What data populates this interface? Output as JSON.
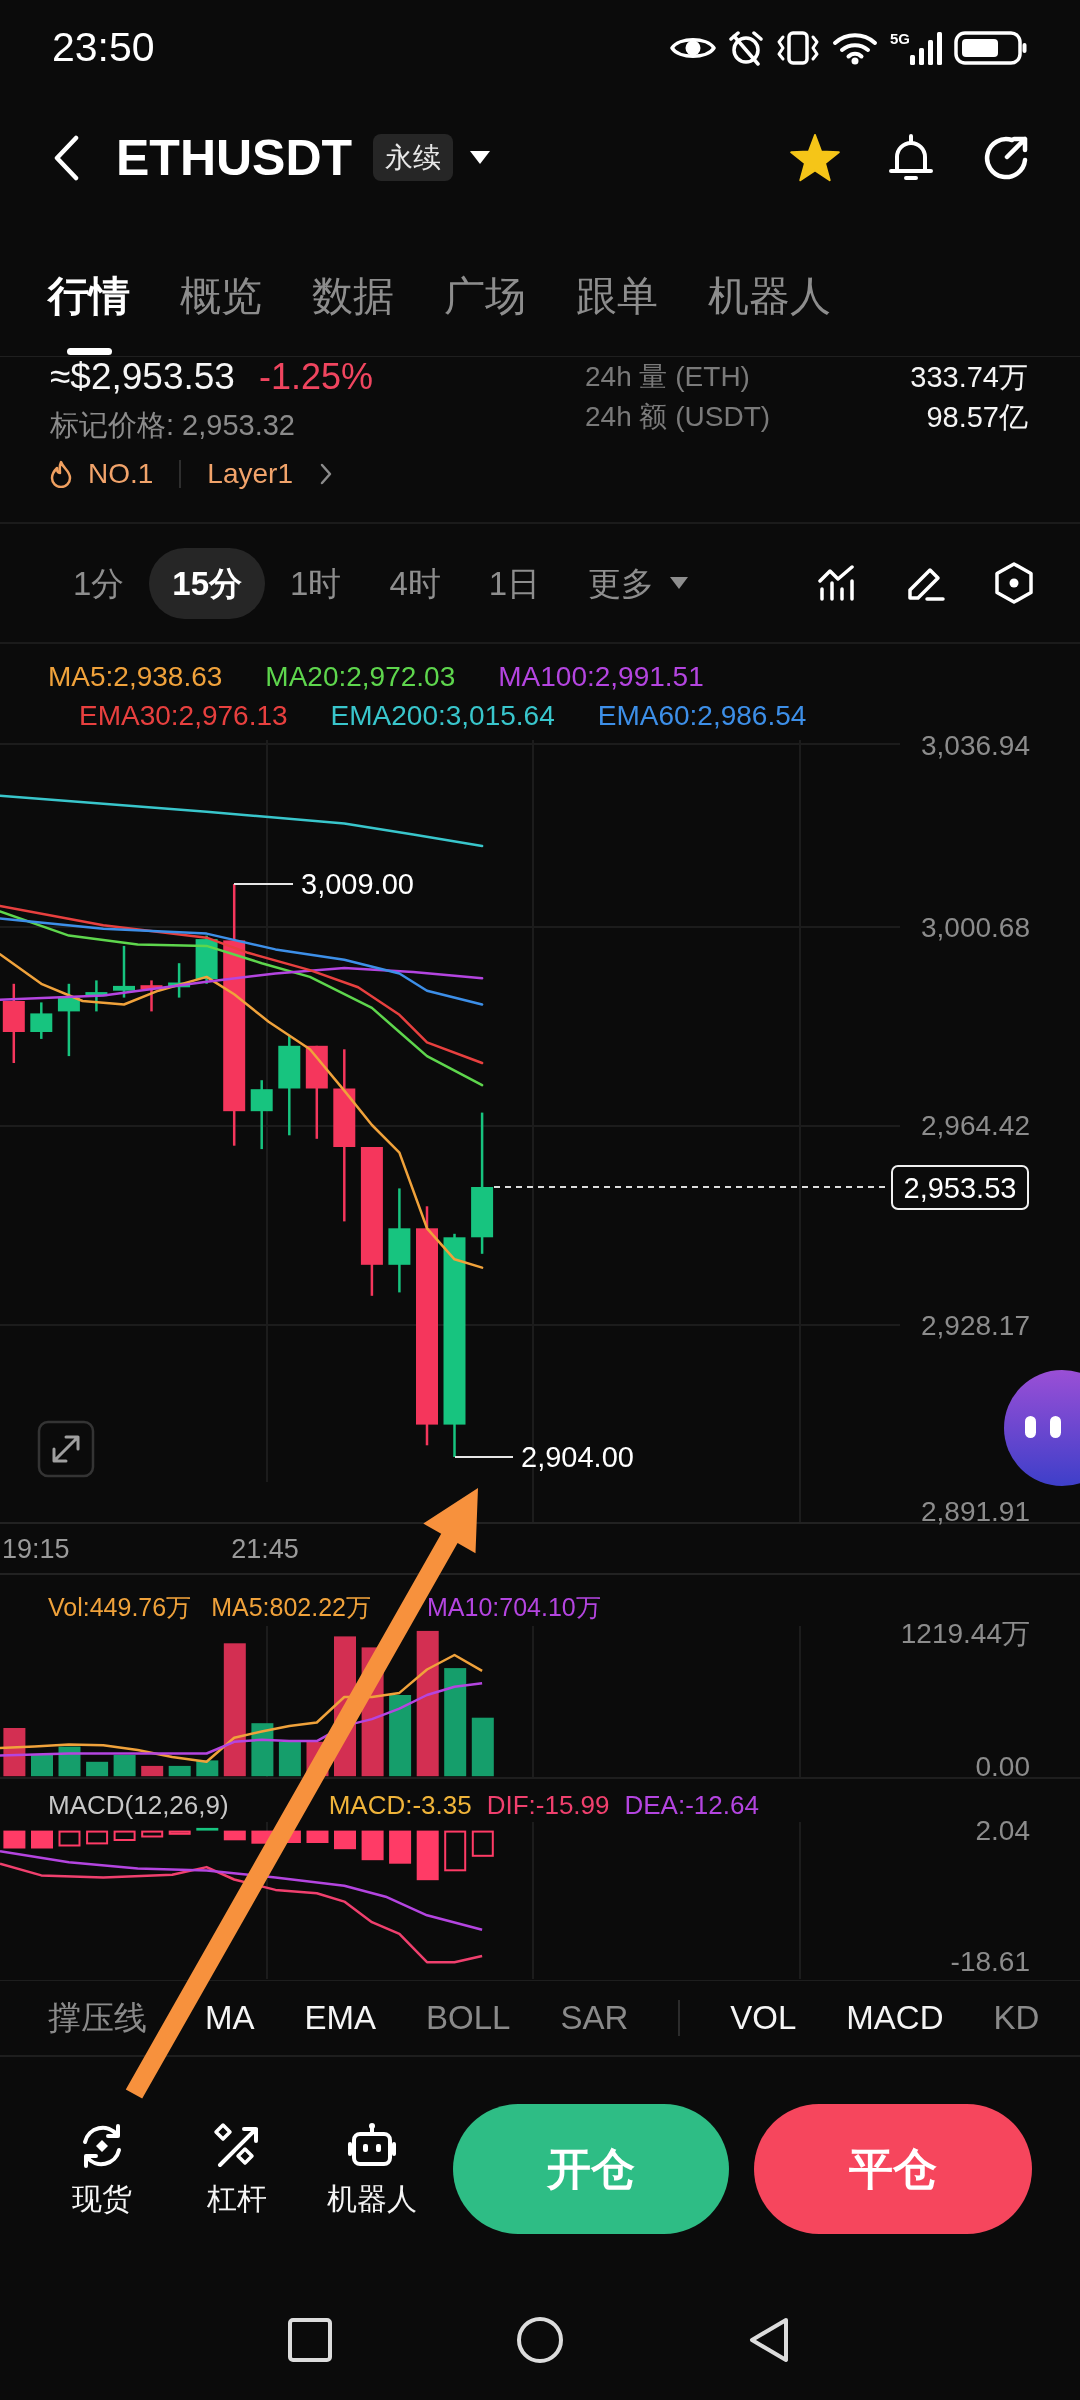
{
  "status_bar": {
    "time": "23:50",
    "network": "5G"
  },
  "header": {
    "title": "ETHUSDT",
    "badge": "永续",
    "favorite": true
  },
  "tabs": [
    {
      "label": "行情",
      "selected": true
    },
    {
      "label": "概览",
      "selected": false
    },
    {
      "label": "数据",
      "selected": false
    },
    {
      "label": "广场",
      "selected": false
    },
    {
      "label": "跟单",
      "selected": false
    },
    {
      "label": "机器人",
      "selected": false
    }
  ],
  "ticker": {
    "price": "≈$2,953.53",
    "change": "-1.25%",
    "mark_price": "标记价格: 2,953.32",
    "rank": "NO.1",
    "sector": "Layer1",
    "stats": [
      {
        "label": "24h 量 (ETH)",
        "value": "333.74万"
      },
      {
        "label": "24h 额 (USDT)",
        "value": "98.57亿"
      }
    ]
  },
  "timeframes": {
    "items": [
      {
        "label": "1分",
        "selected": false
      },
      {
        "label": "15分",
        "selected": true
      },
      {
        "label": "1时",
        "selected": false
      },
      {
        "label": "4时",
        "selected": false
      },
      {
        "label": "1日",
        "selected": false
      }
    ],
    "more": "更多"
  },
  "price_chart": {
    "legend_rows": [
      {
        "items": [
          {
            "text": "MA5:2,938.63",
            "color": "#f0a23b"
          },
          {
            "text": "MA20:2,972.03",
            "color": "#5ed64d"
          },
          {
            "text": "MA100:2,991.51",
            "color": "#b445e0"
          }
        ]
      },
      {
        "items": [
          {
            "text": "EMA30:2,976.13",
            "color": "#e8403f"
          },
          {
            "text": "EMA200:3,015.64",
            "color": "#39c6cc"
          },
          {
            "text": "EMA60:2,986.54",
            "color": "#3d8fe8"
          }
        ]
      }
    ],
    "price_axis": [
      "3,036.94",
      "3,000.68",
      "2,964.42",
      "2,928.17",
      "2,891.91"
    ],
    "high_label": "3,009.00",
    "low_label": "2,904.00",
    "last_price": "2,953.53",
    "time_axis": [
      "19:15",
      "21:45"
    ]
  },
  "volume_chart": {
    "legend": [
      {
        "text": "Vol:449.76万",
        "color": "#f0a23b"
      },
      {
        "text": "MA5:802.22万",
        "color": "#f0a23b"
      },
      {
        "text": "MA10:704.10万",
        "color": "#b445e0"
      }
    ],
    "axis": [
      "1219.44万",
      "0.00"
    ]
  },
  "macd_chart": {
    "legend": [
      {
        "text": "MACD(12,26,9)",
        "color": "#c8c8c8"
      },
      {
        "text": "MACD:-3.35",
        "color": "#f0b43a"
      },
      {
        "text": "DIF:-15.99",
        "color": "#f0406e"
      },
      {
        "text": "DEA:-12.64",
        "color": "#b445e0"
      }
    ],
    "axis": [
      "2.04",
      "-18.61"
    ]
  },
  "indicators": {
    "main": [
      {
        "label": "撑压线",
        "selected": false
      },
      {
        "label": "MA",
        "selected": true
      },
      {
        "label": "EMA",
        "selected": true
      },
      {
        "label": "BOLL",
        "selected": false
      },
      {
        "label": "SAR",
        "selected": false
      }
    ],
    "sub": [
      {
        "label": "VOL",
        "selected": true
      },
      {
        "label": "MACD",
        "selected": true
      },
      {
        "label": "KD",
        "selected": false
      }
    ]
  },
  "bottom_bar": {
    "shortcuts": [
      {
        "label": "现货"
      },
      {
        "label": "杠杆"
      },
      {
        "label": "机器人"
      }
    ],
    "actions": [
      {
        "kind": "open",
        "label": "开仓"
      },
      {
        "kind": "close",
        "label": "平仓"
      }
    ]
  }
}
